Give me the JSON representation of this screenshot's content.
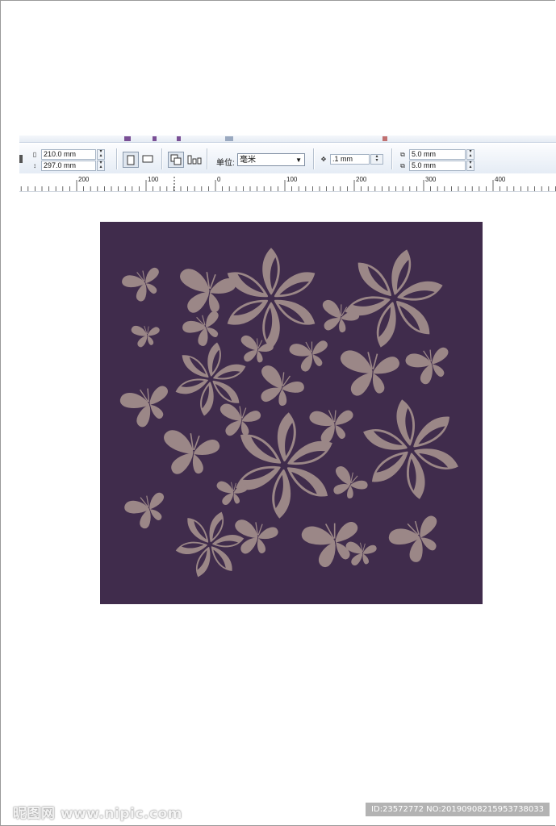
{
  "page_size": {
    "width_value": "210.0 mm",
    "height_value": "297.0 mm"
  },
  "units": {
    "label": "单位:",
    "selected": "毫米"
  },
  "nudge": {
    "value": ".1 mm"
  },
  "duplicate_distance": {
    "x_value": "5.0 mm",
    "y_value": "5.0 mm"
  },
  "ruler": {
    "labels": [
      "200",
      "100",
      "0",
      "100",
      "200",
      "300",
      "400"
    ]
  },
  "artwork": {
    "background_color": "#402c4c",
    "motif_color": "#9b8787",
    "motifs": [
      "flower",
      "butterfly"
    ]
  },
  "watermark": {
    "left": "昵图网 www.nipic.com",
    "right": "ID:23572772 NO:20190908215953738033"
  },
  "colors": {
    "toolbar_bg": "#e5ecf5",
    "accent": "#7a4f95"
  }
}
